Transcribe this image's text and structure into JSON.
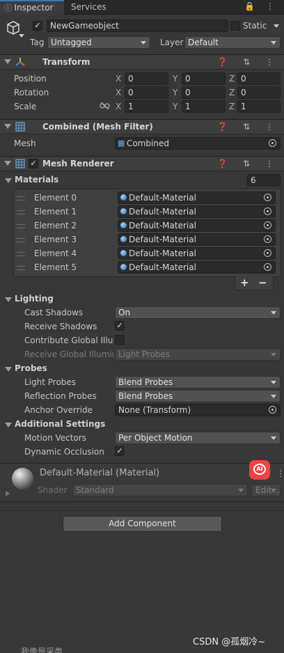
{
  "tabs": [
    {
      "label": "Inspector"
    },
    {
      "label": "Services"
    }
  ],
  "tab_icons": "🔒 ⋮",
  "object": {
    "name": "NewGameobject",
    "static_label": "Static",
    "tag_label": "Tag",
    "tag_value": "Untagged",
    "layer_label": "Layer",
    "layer_value": "Default"
  },
  "transform": {
    "title": "Transform",
    "icons": "❓ ⇅ ⋮",
    "rows": [
      {
        "label": "Position",
        "x": "0",
        "y": "0",
        "z": "0"
      },
      {
        "label": "Rotation",
        "x": "0",
        "y": "0",
        "z": "0"
      },
      {
        "label": "Scale",
        "x": "1",
        "y": "1",
        "z": "1"
      }
    ],
    "axes": {
      "x": "X",
      "y": "Y",
      "z": "Z"
    }
  },
  "mesh_filter": {
    "title": "Combined (Mesh Filter)",
    "mesh_label": "Mesh",
    "mesh_value": "Combined"
  },
  "mesh_renderer": {
    "title": "Mesh Renderer",
    "materials_label": "Materials",
    "materials_count": "6",
    "elements": [
      {
        "label": "Element 0",
        "value": "Default-Material"
      },
      {
        "label": "Element 1",
        "value": "Default-Material"
      },
      {
        "label": "Element 2",
        "value": "Default-Material"
      },
      {
        "label": "Element 3",
        "value": "Default-Material"
      },
      {
        "label": "Element 4",
        "value": "Default-Material"
      },
      {
        "label": "Element 5",
        "value": "Default-Material"
      }
    ],
    "add": "+",
    "remove": "−",
    "lighting": {
      "label": "Lighting",
      "cast_shadows_label": "Cast Shadows",
      "cast_shadows_value": "On",
      "receive_shadows_label": "Receive Shadows",
      "contribute_gi_label": "Contribute Global Illum",
      "receive_gi_label": "Receive Global Illumina",
      "receive_gi_value": "Light Probes"
    },
    "probes": {
      "label": "Probes",
      "light_probes_label": "Light Probes",
      "light_probes_value": "Blend Probes",
      "reflection_probes_label": "Reflection Probes",
      "reflection_probes_value": "Blend Probes",
      "anchor_override_label": "Anchor Override",
      "anchor_override_value": "None (Transform)"
    },
    "additional": {
      "label": "Additional Settings",
      "motion_vectors_label": "Motion Vectors",
      "motion_vectors_value": "Per Object Motion",
      "dynamic_occlusion_label": "Dynamic Occlusion"
    }
  },
  "material": {
    "title": "Default-Material (Material)",
    "shader_label": "Shader",
    "shader_value": "Standard",
    "edit_label": "Edit..."
  },
  "add_component_label": "Add Component",
  "watermark": "CSDN @孤烟冷~",
  "bottom_text": "我像是采类",
  "ai_badge": "AI",
  "check": "✓"
}
